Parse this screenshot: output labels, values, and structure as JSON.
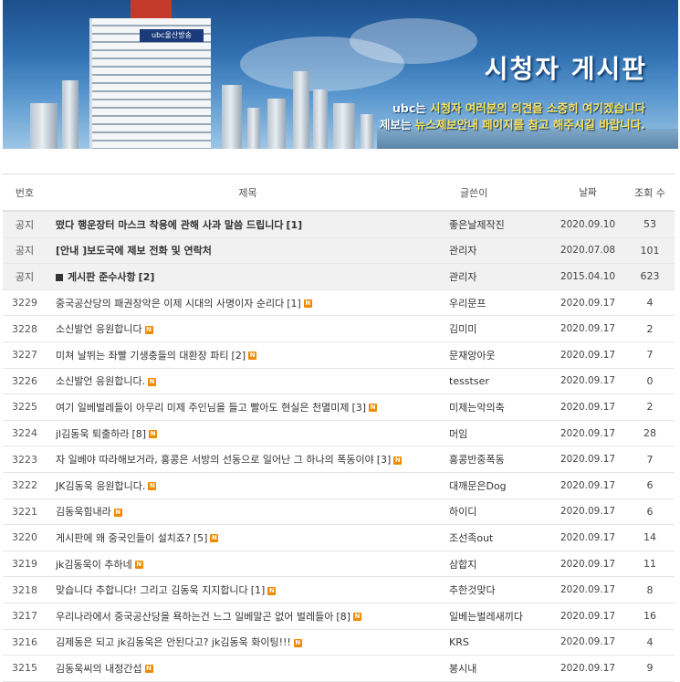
{
  "banner": {
    "title": "시청자 게시판",
    "line1_prefix": "ubc는 ",
    "line1_highlight": "시청자 여러분의 의견을 소중히 여기겠습니다",
    "line2_prefix": "제보는 ",
    "line2_highlight": "뉴스제보안내 페이지를 참고 해주시길 바랍니다.",
    "building_sign": "ubc울산방송"
  },
  "table": {
    "headers": {
      "no": "번호",
      "title": "제목",
      "writer": "글쓴이",
      "date": "날짜",
      "views": "조회 수"
    },
    "notices": [
      {
        "no": "공지",
        "title": "떴다 행운장터 마스크 착용에 관해 사과 말씀 드립니다",
        "count": "[1]",
        "writer": "좋은날제작진",
        "date": "2020.09.10",
        "views": "53"
      },
      {
        "no": "공지",
        "title": "[안내 ]보도국에 제보 전화 및 연락처",
        "count": "",
        "writer": "관리자",
        "date": "2020.07.08",
        "views": "101"
      },
      {
        "no": "공지",
        "title": "게시판 준수사항",
        "count": "[2]",
        "writer": "관리자",
        "date": "2015.04.10",
        "views": "623"
      }
    ],
    "posts": [
      {
        "no": "3229",
        "title": "중국공산당의 패권장악은 이제 시대의 사명이자 순리다",
        "count": "[1]",
        "writer": "우리문프",
        "date": "2020.09.17",
        "views": "4"
      },
      {
        "no": "3228",
        "title": "소신발언 응원합니다",
        "count": "",
        "writer": "김미미",
        "date": "2020.09.17",
        "views": "2"
      },
      {
        "no": "3227",
        "title": "미쳐 날뛰는 좌빨 기생충들의 대환장 파티",
        "count": "[2]",
        "writer": "문재앙아웃",
        "date": "2020.09.17",
        "views": "7"
      },
      {
        "no": "3226",
        "title": "소신발언 응원합니다.",
        "count": "",
        "writer": "tesstser",
        "date": "2020.09.17",
        "views": "0"
      },
      {
        "no": "3225",
        "title": "여기 일베벌레들이 아무리 미제 주인님을 들고 빨아도 현실은 천멸미제",
        "count": "[3]",
        "writer": "미제는악의축",
        "date": "2020.09.17",
        "views": "2"
      },
      {
        "no": "3224",
        "title": "jl김동욱 퇴출하라",
        "count": "[8]",
        "writer": "머임",
        "date": "2020.09.17",
        "views": "28"
      },
      {
        "no": "3223",
        "title": "자 일베야 따라해보거라, 홍콩은 서방의 선동으로 일어난 그 하나의 폭동이야",
        "count": "[3]",
        "writer": "홍콩반중폭동",
        "date": "2020.09.17",
        "views": "7"
      },
      {
        "no": "3222",
        "title": "JK김동욱 응원합니다.",
        "count": "",
        "writer": "대깨문은Dog",
        "date": "2020.09.17",
        "views": "6"
      },
      {
        "no": "3221",
        "title": "김동욱힘내라",
        "count": "",
        "writer": "하이디",
        "date": "2020.09.17",
        "views": "6"
      },
      {
        "no": "3220",
        "title": "게시판에 왜 중국인들이 설치죠?",
        "count": "[5]",
        "writer": "조선족out",
        "date": "2020.09.17",
        "views": "14"
      },
      {
        "no": "3219",
        "title": "jk김동욱이 추하네",
        "count": "",
        "writer": "삼합지",
        "date": "2020.09.17",
        "views": "11"
      },
      {
        "no": "3218",
        "title": "맞습니다 추합니다! 그리고 김동욱 지지합니다",
        "count": "[1]",
        "writer": "추한것맞다",
        "date": "2020.09.17",
        "views": "8"
      },
      {
        "no": "3217",
        "title": "우리나라에서 중국공산당을 욕하는건 느그 일베말곤 없어 벌레들아",
        "count": "[8]",
        "writer": "일베는벌레새끼다",
        "date": "2020.09.17",
        "views": "16"
      },
      {
        "no": "3216",
        "title": "김제동은 되고 jk김동욱은 안된다고? jk김동욱 화이팅!!!",
        "count": "",
        "writer": "KRS",
        "date": "2020.09.17",
        "views": "4"
      },
      {
        "no": "3215",
        "title": "김동욱씨의 내정간섭",
        "count": "",
        "writer": "봉시내",
        "date": "2020.09.17",
        "views": "9"
      }
    ],
    "new_badge": "N"
  },
  "colors": {
    "banner_top": "#1d4f8c",
    "highlight": "#ffe45a",
    "new_badge": "#f08a00",
    "notice_bg": "#f1f1f1"
  }
}
